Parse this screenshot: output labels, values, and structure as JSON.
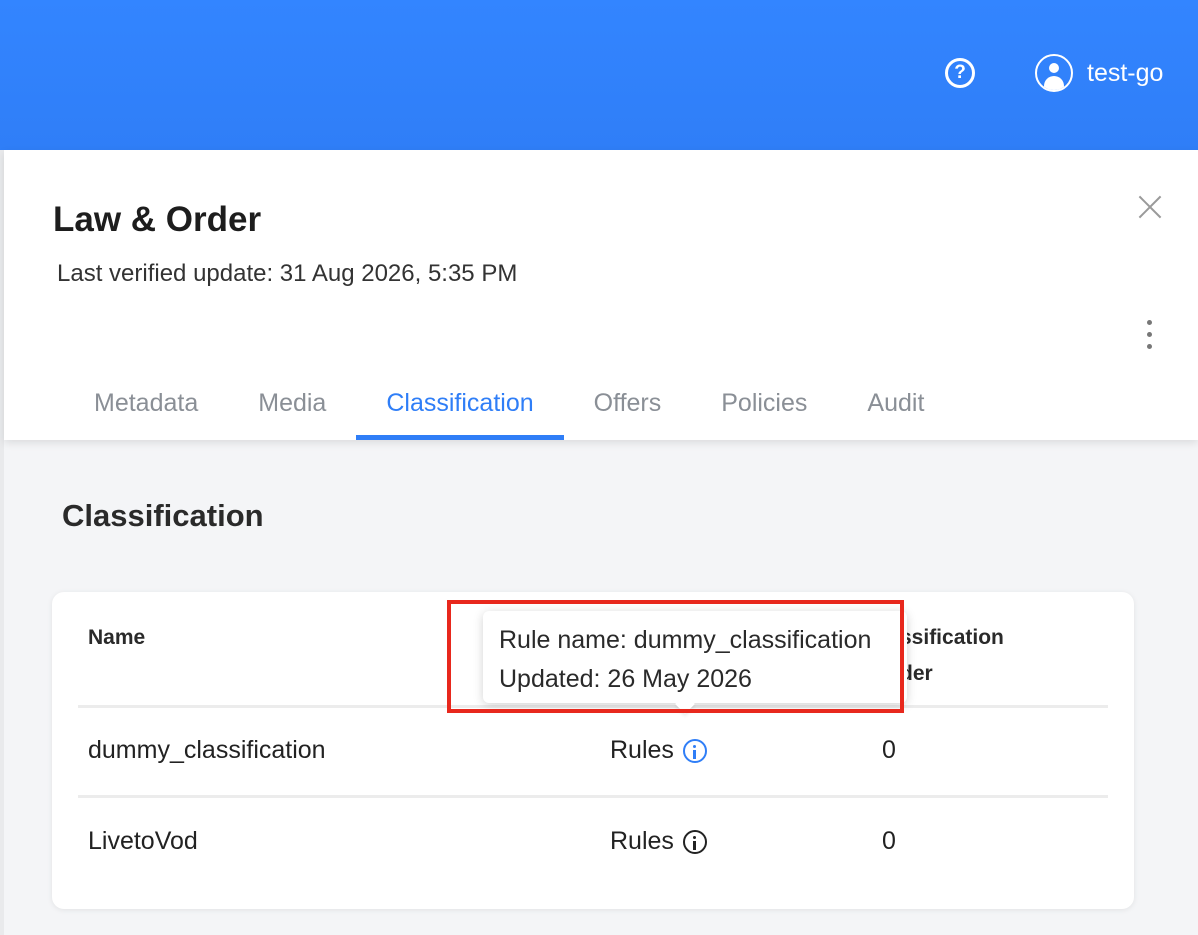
{
  "topbar": {
    "help_icon": "question-circle-icon",
    "help_glyph": "?",
    "user_icon": "user-circle-icon",
    "user_name": "test-go"
  },
  "panel": {
    "title": "Law & Order",
    "subtitle": "Last verified update: 31 Aug 2026, 5:35 PM",
    "close_icon": "close-icon",
    "more_icon": "more-vertical-icon"
  },
  "tabs": [
    {
      "label": "Metadata",
      "active": false
    },
    {
      "label": "Media",
      "active": false
    },
    {
      "label": "Classification",
      "active": true
    },
    {
      "label": "Offers",
      "active": false
    },
    {
      "label": "Policies",
      "active": false
    },
    {
      "label": "Audit",
      "active": false
    }
  ],
  "section": {
    "title": "Classification"
  },
  "table": {
    "headers": {
      "name": "Name",
      "classification_order_line1": "ssification",
      "classification_order_line2": "der"
    },
    "rows": [
      {
        "name": "dummy_classification",
        "rules": "Rules",
        "order": "0",
        "info_icon": "info-icon",
        "info_active": true
      },
      {
        "name": "LivetoVod",
        "rules": "Rules",
        "order": "0",
        "info_icon": "info-icon",
        "info_active": false
      }
    ]
  },
  "tooltip": {
    "line1": "Rule name: dummy_classification",
    "line2": "Updated: 26 May 2026"
  },
  "colors": {
    "accent": "#2f7ef7",
    "highlight": "#e8281d"
  }
}
